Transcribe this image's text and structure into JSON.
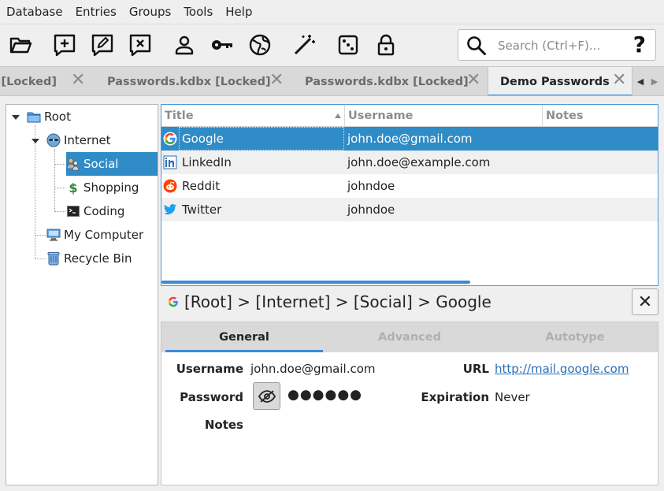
{
  "menu": {
    "items": [
      {
        "label": "Database"
      },
      {
        "label": "Entries"
      },
      {
        "label": "Groups"
      },
      {
        "label": "Tools"
      },
      {
        "label": "Help"
      }
    ]
  },
  "toolbar": {
    "buttons": [
      {
        "icon": "open-folder-icon"
      },
      {
        "icon": "add-entry-icon"
      },
      {
        "icon": "edit-entry-icon"
      },
      {
        "icon": "delete-entry-icon"
      },
      {
        "icon": "user-icon"
      },
      {
        "icon": "key-icon"
      },
      {
        "icon": "globe-icon"
      },
      {
        "icon": "magic-wand-icon"
      },
      {
        "icon": "dice-icon"
      },
      {
        "icon": "lock-icon"
      }
    ],
    "search": {
      "placeholder": "Search (Ctrl+F)...",
      "value": "",
      "help": "?"
    }
  },
  "tabs": [
    {
      "label": "x [Locked]",
      "active": false
    },
    {
      "label": "Passwords.kdbx [Locked]",
      "active": false
    },
    {
      "label": "Passwords.kdbx [Locked]",
      "active": false
    },
    {
      "label": "Demo Passwords",
      "active": true
    }
  ],
  "tab_close_glyph": "✕",
  "tree": {
    "items": [
      {
        "label": "Root",
        "icon": "folder-icon",
        "level": 0,
        "expanded": true
      },
      {
        "label": "Internet",
        "icon": "network-globe-icon",
        "level": 1,
        "expanded": true
      },
      {
        "label": "Social",
        "icon": "people-icon",
        "level": 2,
        "selected": true
      },
      {
        "label": "Shopping",
        "icon": "dollar-icon",
        "level": 2
      },
      {
        "label": "Coding",
        "icon": "terminal-icon",
        "level": 2
      },
      {
        "label": "My Computer",
        "icon": "computer-icon",
        "level": 1
      },
      {
        "label": "Recycle Bin",
        "icon": "trash-bin-icon",
        "level": 1
      }
    ]
  },
  "entries": {
    "columns": [
      "Title",
      "Username",
      "Notes"
    ],
    "rows": [
      {
        "title": "Google",
        "username": "john.doe@gmail.com",
        "notes": "",
        "icon": "google-icon",
        "selected": true
      },
      {
        "title": "LinkedIn",
        "username": "john.doe@example.com",
        "notes": "",
        "icon": "linkedin-icon"
      },
      {
        "title": "Reddit",
        "username": "johndoe",
        "notes": "",
        "icon": "reddit-icon"
      },
      {
        "title": "Twitter",
        "username": "johndoe",
        "notes": "",
        "icon": "twitter-icon"
      }
    ]
  },
  "details": {
    "path": "[Root] > [Internet] > [Social] > Google",
    "close": "✕",
    "tabs": [
      "General",
      "Advanced",
      "Autotype"
    ],
    "fields": {
      "username_label": "Username",
      "username_value": "john.doe@gmail.com",
      "password_label": "Password",
      "password_value": "●●●●●●",
      "notes_label": "Notes",
      "url_label": "URL",
      "url_value": "http://mail.google.com",
      "expiration_label": "Expiration",
      "expiration_value": "Never"
    }
  },
  "colors": {
    "selection": "#308cc6",
    "accent": "#3a8ad8",
    "link": "#2a6fb8"
  }
}
